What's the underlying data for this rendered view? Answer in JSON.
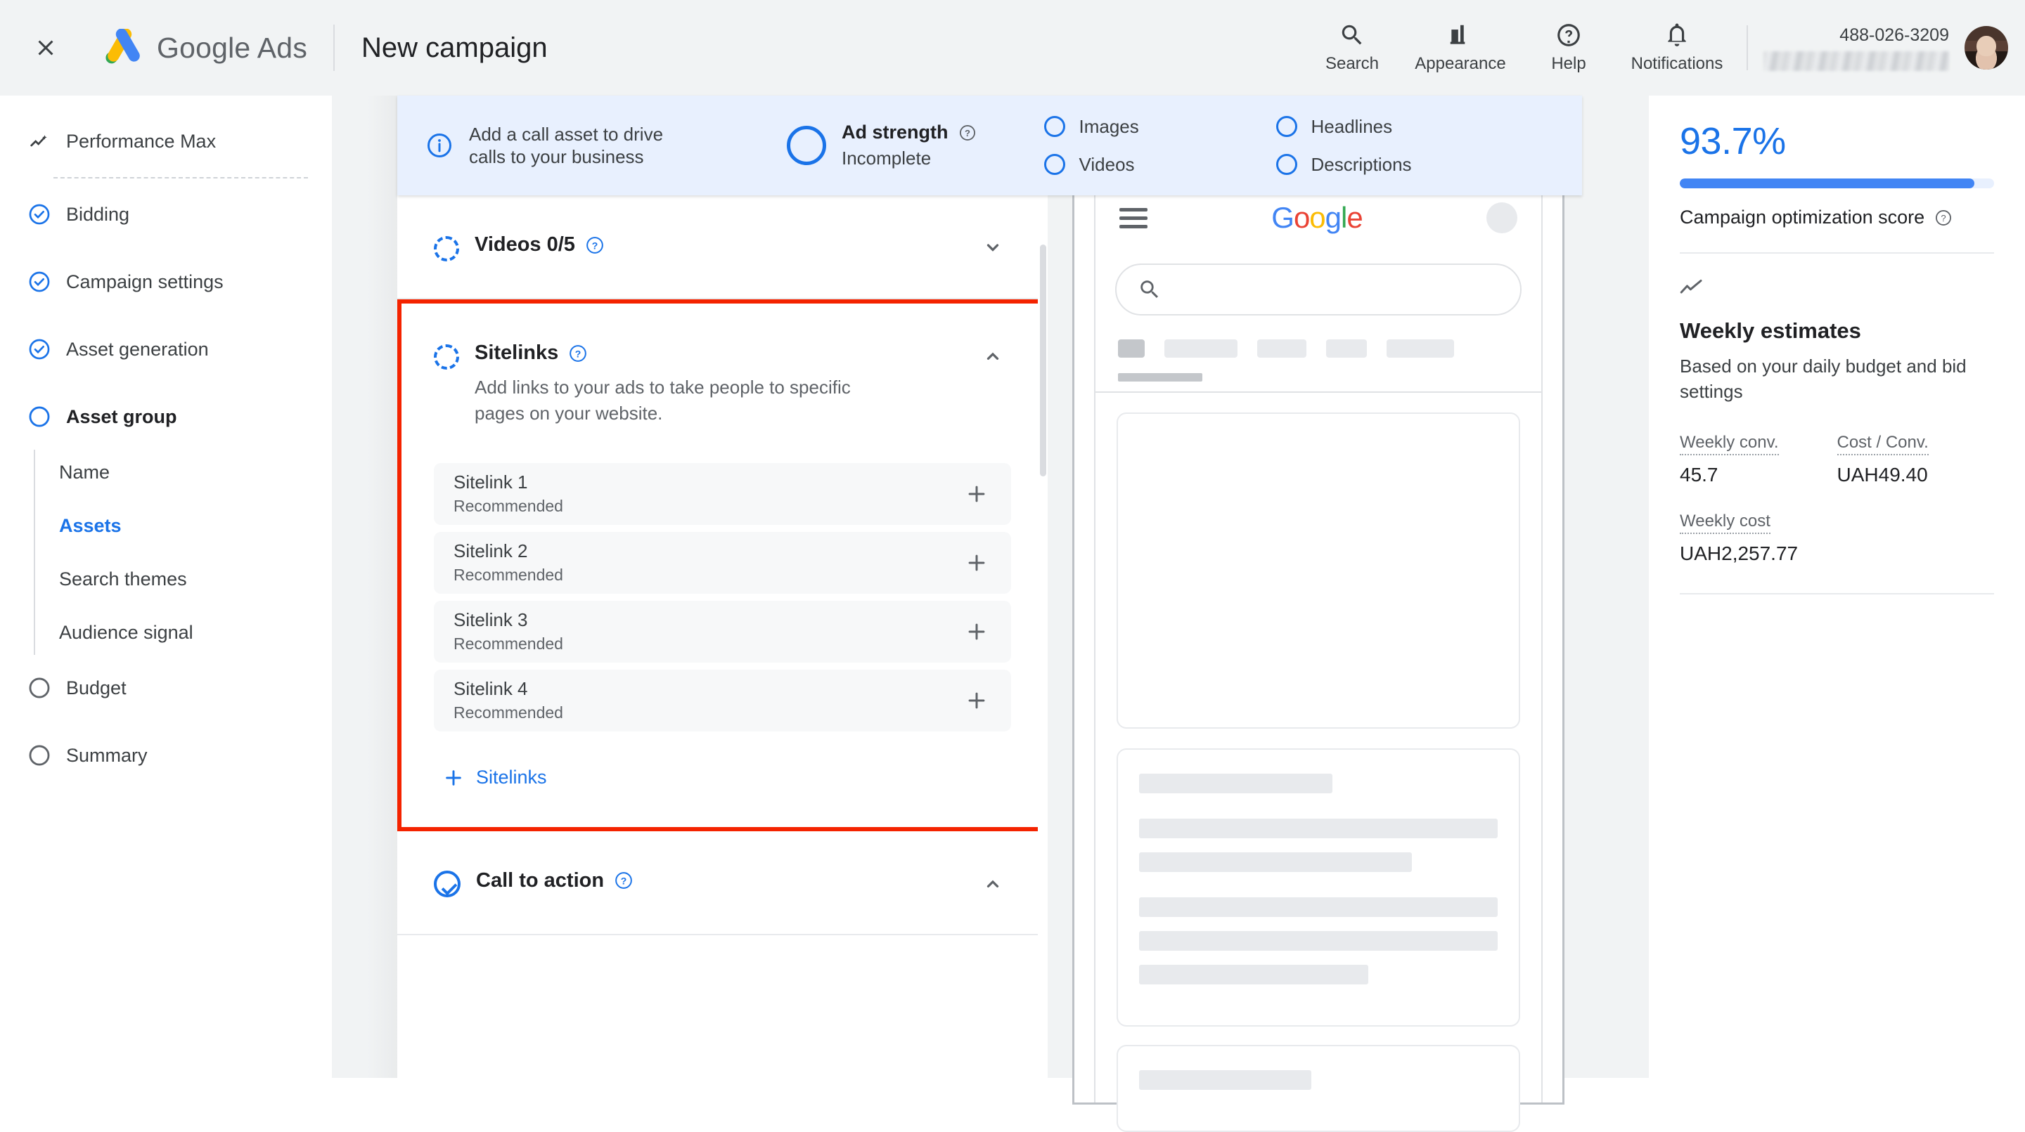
{
  "topbar": {
    "close_icon": "close-icon",
    "brand_google": "Google",
    "brand_ads": "Ads",
    "page_title": "New campaign",
    "items": [
      {
        "icon": "search-icon",
        "label": "Search"
      },
      {
        "icon": "appearance-icon",
        "label": "Appearance"
      },
      {
        "icon": "help-icon",
        "label": "Help"
      },
      {
        "icon": "bell-icon",
        "label": "Notifications"
      }
    ],
    "account_id": "488-026-3209"
  },
  "sidebar": {
    "top_item": {
      "label": "Performance Max",
      "icon": "performance-icon"
    },
    "steps": [
      {
        "label": "Bidding",
        "state": "complete"
      },
      {
        "label": "Campaign settings",
        "state": "complete"
      },
      {
        "label": "Asset generation",
        "state": "complete"
      },
      {
        "label": "Asset group",
        "state": "current"
      }
    ],
    "subitems": [
      {
        "label": "Name",
        "active": false
      },
      {
        "label": "Assets",
        "active": true
      },
      {
        "label": "Search themes",
        "active": false
      },
      {
        "label": "Audience signal",
        "active": false
      }
    ],
    "steps_after": [
      {
        "label": "Budget",
        "state": "todo"
      },
      {
        "label": "Summary",
        "state": "todo"
      }
    ]
  },
  "banner": {
    "info_icon": "info-icon",
    "call_text_line1": "Add a call asset to drive",
    "call_text_line2": "calls to your business",
    "ad_strength_title": "Ad strength",
    "ad_strength_value": "Incomplete",
    "checks_left": [
      "Images",
      "Videos"
    ],
    "checks_right": [
      "Headlines",
      "Descriptions"
    ]
  },
  "main": {
    "videos_section": {
      "title": "Videos 0/5",
      "collapsed": true
    },
    "sitelinks_section": {
      "title": "Sitelinks",
      "description": "Add links to your ads to take people to specific pages on your website.",
      "rows": [
        {
          "name": "Sitelink 1",
          "status": "Recommended"
        },
        {
          "name": "Sitelink 2",
          "status": "Recommended"
        },
        {
          "name": "Sitelink 3",
          "status": "Recommended"
        },
        {
          "name": "Sitelink 4",
          "status": "Recommended"
        }
      ],
      "add_label": "Sitelinks",
      "highlight_color": "#f42300"
    },
    "cta_section": {
      "title": "Call to action"
    }
  },
  "preview": {
    "logo_letters": [
      {
        "ch": "G",
        "color": "#4285f4"
      },
      {
        "ch": "o",
        "color": "#ea4335"
      },
      {
        "ch": "o",
        "color": "#fbbc04"
      },
      {
        "ch": "g",
        "color": "#4285f4"
      },
      {
        "ch": "l",
        "color": "#34a853"
      },
      {
        "ch": "e",
        "color": "#ea4335"
      }
    ],
    "search_icon": "search-icon",
    "menu_icon": "hamburger-icon"
  },
  "rightpanel": {
    "score_percent": "93.7%",
    "score_fill_pct": 93.7,
    "score_label": "Campaign optimization score",
    "weekly_title": "Weekly estimates",
    "weekly_sub": "Based on your daily budget and bid settings",
    "metrics": [
      {
        "label": "Weekly conv.",
        "value": "45.7"
      },
      {
        "label": "Cost / Conv.",
        "value": "UAH49.40"
      },
      {
        "label": "Weekly cost",
        "value": "UAH2,257.77"
      }
    ]
  }
}
